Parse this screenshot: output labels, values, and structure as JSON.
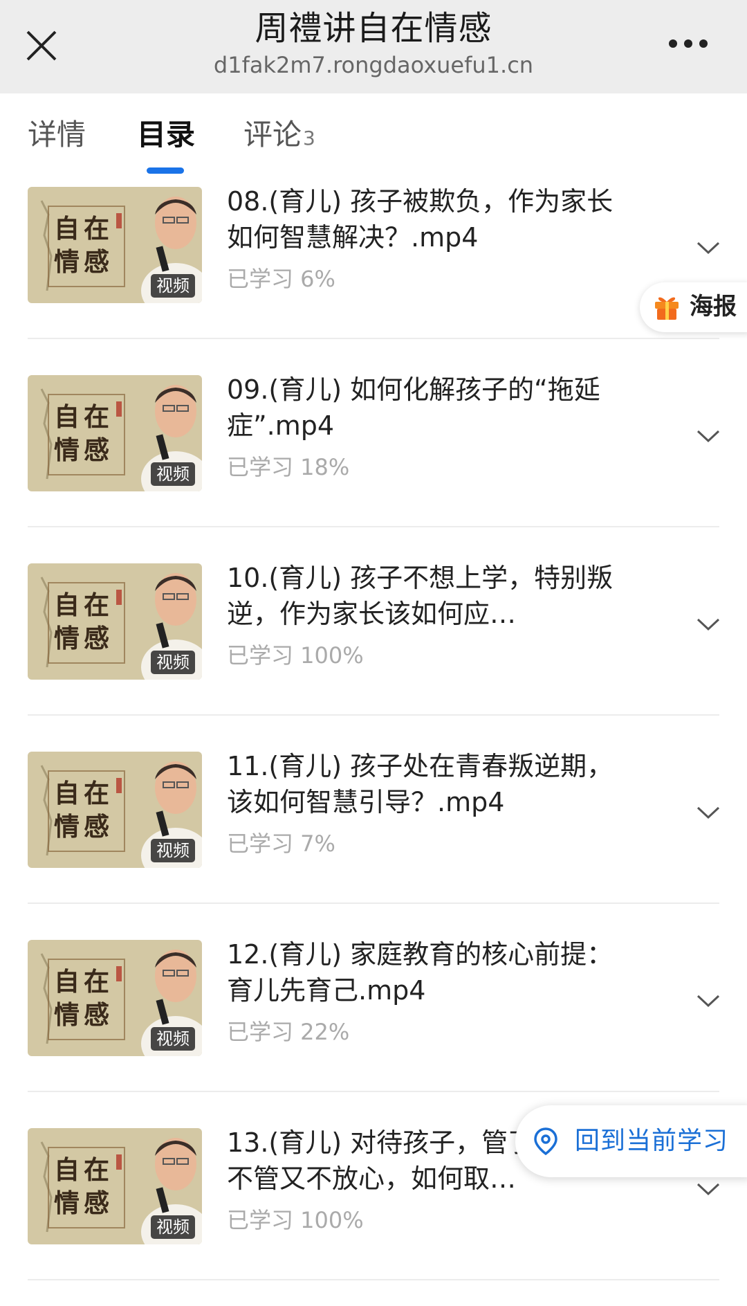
{
  "header": {
    "title": "周禮讲自在情感",
    "url": "d1fak2m7.rongdaoxuefu1.cn",
    "close_icon": "close-icon",
    "more_icon": "more-horizontal-icon"
  },
  "tabs": [
    {
      "label": "详情",
      "count": ""
    },
    {
      "label": "目录",
      "count": ""
    },
    {
      "label": "评论",
      "count": "3"
    }
  ],
  "active_tab": "目录",
  "accent_color": "#1a73e8",
  "thumbnail": {
    "text_line1": "自在",
    "text_line2": "情感",
    "badge": "视频"
  },
  "lessons": [
    {
      "title": "08.(育儿) 孩子被欺负，作为家长如何智慧解决？.mp4",
      "progress": "已学习 6%"
    },
    {
      "title": "09.(育儿) 如何化解孩子的“拖延症”.mp4",
      "progress": "已学习 18%"
    },
    {
      "title": "10.(育儿) 孩子不想上学，特别叛逆，作为家长该如何应…",
      "progress": "已学习 100%"
    },
    {
      "title": "11.(育儿) 孩子处在青春叛逆期，该如何智慧引导？.mp4",
      "progress": "已学习 7%"
    },
    {
      "title": "12.(育儿) 家庭教育的核心前提：育儿先育己.mp4",
      "progress": "已学习 22%"
    },
    {
      "title": "13.(育儿) 对待孩子，管了逆反，不管又不放心，如何取…",
      "progress": "已学习 100%"
    }
  ],
  "poster_button": {
    "label": "海报",
    "icon": "gift-icon"
  },
  "back_button": {
    "label": "回到当前学习",
    "icon": "location-pin-icon",
    "color": "#1a6fd6"
  }
}
